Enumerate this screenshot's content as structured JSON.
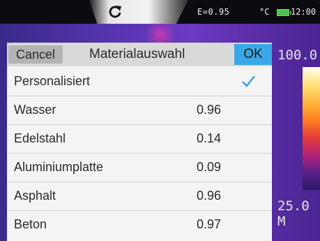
{
  "status": {
    "emissivity": "E=0.95",
    "unit": "°C",
    "time": "12:00"
  },
  "scale": {
    "max": "100.0",
    "min": "25.0",
    "mode": "M"
  },
  "dialog": {
    "cancel_label": "Cancel",
    "title": "Materialauswahl",
    "ok_label": "OK"
  },
  "materials": [
    {
      "name": "Personalisiert",
      "value": "",
      "selected": true
    },
    {
      "name": "Wasser",
      "value": "0.96"
    },
    {
      "name": "Edelstahl",
      "value": "0.14"
    },
    {
      "name": "Aluminiumplatte",
      "value": "0.09"
    },
    {
      "name": "Asphalt",
      "value": "0.96"
    },
    {
      "name": "Beton",
      "value": "0.97"
    }
  ],
  "icons": {
    "rotate": "rotate-icon",
    "battery": "battery-icon",
    "check": "check-icon"
  },
  "colors": {
    "ok_button": "#3aa8e8",
    "check": "#3aa0e0"
  }
}
